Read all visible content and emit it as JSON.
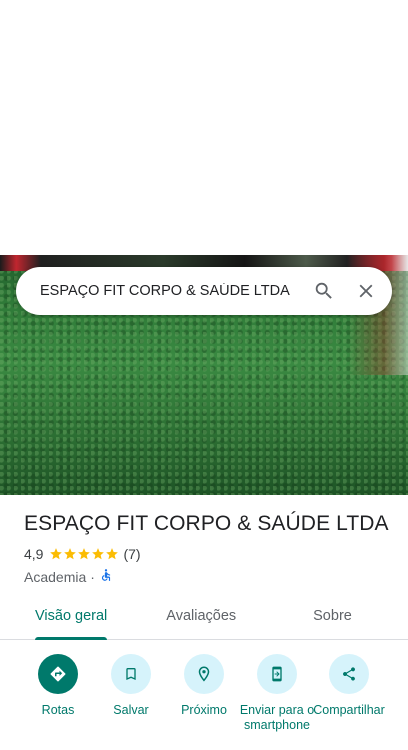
{
  "search": {
    "query": "ESPAÇO FIT CORPO & SAÚDE LTDA"
  },
  "place": {
    "name": "ESPAÇO FIT CORPO & SAÚDE LTDA",
    "rating": "4,9",
    "stars": 5,
    "review_count": "(7)",
    "category": "Academia",
    "separator": "·"
  },
  "tabs": [
    {
      "label": "Visão geral",
      "active": true
    },
    {
      "label": "Avaliações",
      "active": false
    },
    {
      "label": "Sobre",
      "active": false
    }
  ],
  "actions": [
    {
      "label": "Rotas",
      "icon": "directions-icon"
    },
    {
      "label": "Salvar",
      "icon": "bookmark-icon"
    },
    {
      "label": "Próximo",
      "icon": "nearby-icon"
    },
    {
      "label": "Enviar para o smartphone",
      "icon": "send-to-phone-icon"
    },
    {
      "label": "Compartilhar",
      "icon": "share-icon"
    }
  ],
  "colors": {
    "accent": "#00796b",
    "star": "#fbbc04",
    "action_bg": "#d6f3fb"
  }
}
